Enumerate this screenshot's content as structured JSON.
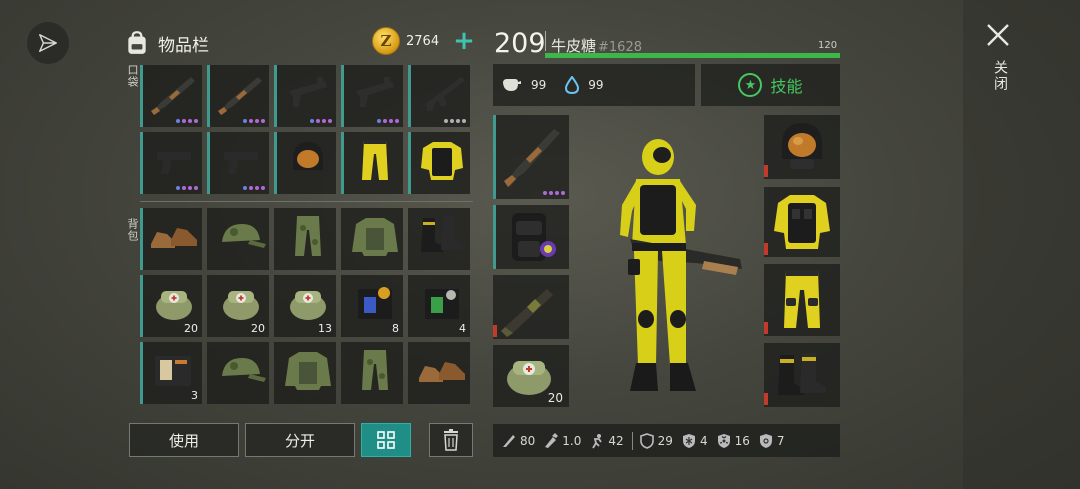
{
  "inventory": {
    "title": "物品栏",
    "pockets_label": "口袋",
    "backpack_label": "背包",
    "coins": "2764",
    "coin_symbol": "Z",
    "add_symbol": "+",
    "pockets": [
      {
        "name": "pump-shotgun",
        "rarity": "purple",
        "dots": 4
      },
      {
        "name": "pump-shotgun",
        "rarity": "purple",
        "dots": 4
      },
      {
        "name": "uzi-smg",
        "rarity": "purple",
        "dots": 4
      },
      {
        "name": "uzi-smg",
        "rarity": "purple",
        "dots": 4
      },
      {
        "name": "assault-rifle",
        "rarity": "grey",
        "dots": 4
      },
      {
        "name": "pistol",
        "rarity": "purple",
        "dots": 4
      },
      {
        "name": "pistol",
        "rarity": "purple",
        "dots": 4
      },
      {
        "name": "hazmat-helmet",
        "rarity": "",
        "dots": 0
      },
      {
        "name": "yellow-pants",
        "rarity": "",
        "dots": 0
      },
      {
        "name": "yellow-armor-vest",
        "rarity": "",
        "dots": 0
      }
    ],
    "backpack": [
      {
        "name": "brown-shoes",
        "count": ""
      },
      {
        "name": "camo-cap",
        "count": ""
      },
      {
        "name": "camo-pants",
        "count": ""
      },
      {
        "name": "camo-jacket",
        "count": ""
      },
      {
        "name": "black-boots",
        "count": ""
      },
      {
        "name": "medkit-bag",
        "count": "20"
      },
      {
        "name": "medkit-bag",
        "count": "20"
      },
      {
        "name": "medkit-bag",
        "count": "13"
      },
      {
        "name": "blue-notebook",
        "count": "8"
      },
      {
        "name": "green-notebook",
        "count": "4"
      },
      {
        "name": "wallet-book",
        "count": "3"
      },
      {
        "name": "camo-cap",
        "count": ""
      },
      {
        "name": "camo-jacket",
        "count": ""
      },
      {
        "name": "camo-pants",
        "count": ""
      },
      {
        "name": "brown-shoes",
        "count": ""
      }
    ],
    "buttons": {
      "use": "使用",
      "split": "分开"
    }
  },
  "character": {
    "level": "209",
    "name": "牛皮糖",
    "id": "#1628",
    "xp_max": "120",
    "xp_fraction": 1.0,
    "hunger": "99",
    "thirst": "99",
    "skills_label": "技能",
    "weapon_slots": [
      {
        "name": "pump-shotgun",
        "count": ""
      },
      {
        "name": "black-backpack",
        "count": ""
      },
      {
        "name": "grenade-launcher",
        "count": ""
      },
      {
        "name": "medkit-bag",
        "count": "20"
      }
    ],
    "armor_slots": [
      {
        "name": "hazmat-helmet"
      },
      {
        "name": "yellow-armor-vest"
      },
      {
        "name": "yellow-pants"
      },
      {
        "name": "black-boots"
      }
    ],
    "stats": {
      "melee": "80",
      "fire_rate": "1.0",
      "speed": "42",
      "defense": "29",
      "cold": "4",
      "radiation": "16",
      "bio": "7"
    }
  },
  "close_label": "关闭",
  "colors": {
    "accent": "#3f9a90",
    "xp": "#3cb84a",
    "skills": "#45c860"
  }
}
